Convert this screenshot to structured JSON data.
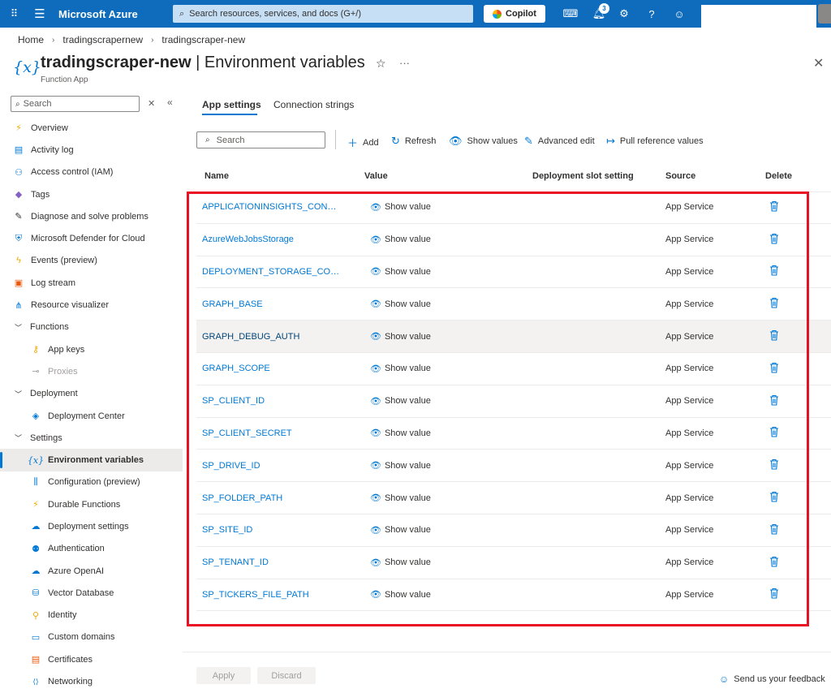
{
  "topbar": {
    "brand": "Microsoft Azure",
    "search_placeholder": "Search resources, services, and docs (G+/)",
    "copilot_label": "Copilot",
    "notification_count": "3"
  },
  "breadcrumb": [
    "Home",
    "tradingscrapernew",
    "tradingscraper-new"
  ],
  "header": {
    "resource_name": "tradingscraper-new",
    "separator": " | ",
    "page_name": "Environment variables",
    "subtitle": "Function App",
    "icon_glyph": "{x}"
  },
  "sidebar": {
    "search_placeholder": "Search",
    "items": [
      {
        "label": "Overview",
        "icon": "lightning-code-icon",
        "color": "#f2a900",
        "glyph": "⚡"
      },
      {
        "label": "Activity log",
        "icon": "activity-log-icon",
        "color": "#0078d4",
        "glyph": "▤"
      },
      {
        "label": "Access control (IAM)",
        "icon": "people-icon",
        "color": "#0078d4",
        "glyph": "⚇"
      },
      {
        "label": "Tags",
        "icon": "tag-icon",
        "color": "#8661c5",
        "glyph": "◆"
      },
      {
        "label": "Diagnose and solve problems",
        "icon": "wrench-icon",
        "color": "#323130",
        "glyph": "✎"
      },
      {
        "label": "Microsoft Defender for Cloud",
        "icon": "shield-icon",
        "color": "#0078d4",
        "glyph": "⛨"
      },
      {
        "label": "Events (preview)",
        "icon": "lightning-icon",
        "color": "#f2a900",
        "glyph": "ϟ"
      },
      {
        "label": "Log stream",
        "icon": "log-stream-icon",
        "color": "#e8590c",
        "glyph": "▣"
      },
      {
        "label": "Resource visualizer",
        "icon": "hierarchy-icon",
        "color": "#0078d4",
        "glyph": "⋔"
      }
    ],
    "groups": {
      "functions": "Functions",
      "deployment": "Deployment",
      "settings": "Settings"
    },
    "functions_items": [
      {
        "label": "App keys",
        "icon": "key-icon",
        "color": "#f2a900",
        "glyph": "⚷"
      },
      {
        "label": "Proxies",
        "icon": "proxies-icon",
        "color": "#a19f9d",
        "glyph": "⊸"
      }
    ],
    "deployment_items": [
      {
        "label": "Deployment Center",
        "icon": "cube-icon",
        "color": "#0078d4",
        "glyph": "◈"
      }
    ],
    "settings_items": [
      {
        "label": "Environment variables",
        "icon": "variable-icon",
        "color": "#0078d4",
        "glyph": "{x}"
      },
      {
        "label": "Configuration (preview)",
        "icon": "sliders-icon",
        "color": "#0078d4",
        "glyph": "⫼"
      },
      {
        "label": "Durable Functions",
        "icon": "durable-functions-icon",
        "color": "#f2a900",
        "glyph": "⚡"
      },
      {
        "label": "Deployment settings",
        "icon": "cloud-settings-icon",
        "color": "#0078d4",
        "glyph": "☁"
      },
      {
        "label": "Authentication",
        "icon": "person-key-icon",
        "color": "#0078d4",
        "glyph": "⚉"
      },
      {
        "label": "Azure OpenAI",
        "icon": "cloud-ai-icon",
        "color": "#0078d4",
        "glyph": "☁"
      },
      {
        "label": "Vector Database",
        "icon": "database-icon",
        "color": "#0078d4",
        "glyph": "⛁"
      },
      {
        "label": "Identity",
        "icon": "identity-icon",
        "color": "#f2a900",
        "glyph": "⚲"
      },
      {
        "label": "Custom domains",
        "icon": "www-icon",
        "color": "#0078d4",
        "glyph": "▭"
      },
      {
        "label": "Certificates",
        "icon": "certificate-icon",
        "color": "#e8590c",
        "glyph": "▤"
      },
      {
        "label": "Networking",
        "icon": "networking-icon",
        "color": "#0078d4",
        "glyph": "⟨⟩"
      }
    ]
  },
  "tabs": [
    "App settings",
    "Connection strings"
  ],
  "toolbar": {
    "search_placeholder": "Search",
    "add": "Add",
    "refresh": "Refresh",
    "show_values": "Show values",
    "advanced_edit": "Advanced edit",
    "pull_reference_values": "Pull reference values"
  },
  "table": {
    "columns": [
      "Name",
      "Value",
      "Deployment slot setting",
      "Source",
      "Delete"
    ],
    "show_value_label": "Show value",
    "rows": [
      {
        "name": "APPLICATIONINSIGHTS_CONNE...",
        "source": "App Service"
      },
      {
        "name": "AzureWebJobsStorage",
        "source": "App Service"
      },
      {
        "name": "DEPLOYMENT_STORAGE_CON...",
        "source": "App Service"
      },
      {
        "name": "GRAPH_BASE",
        "source": "App Service"
      },
      {
        "name": "GRAPH_DEBUG_AUTH",
        "source": "App Service"
      },
      {
        "name": "GRAPH_SCOPE",
        "source": "App Service"
      },
      {
        "name": "SP_CLIENT_ID",
        "source": "App Service"
      },
      {
        "name": "SP_CLIENT_SECRET",
        "source": "App Service"
      },
      {
        "name": "SP_DRIVE_ID",
        "source": "App Service"
      },
      {
        "name": "SP_FOLDER_PATH",
        "source": "App Service"
      },
      {
        "name": "SP_SITE_ID",
        "source": "App Service"
      },
      {
        "name": "SP_TENANT_ID",
        "source": "App Service"
      },
      {
        "name": "SP_TICKERS_FILE_PATH",
        "source": "App Service"
      }
    ]
  },
  "footer": {
    "apply": "Apply",
    "discard": "Discard",
    "feedback": "Send us your feedback"
  },
  "colors": {
    "azure_blue": "#0f6cbd",
    "link_blue": "#0078d4",
    "highlight_red": "#e81123"
  }
}
